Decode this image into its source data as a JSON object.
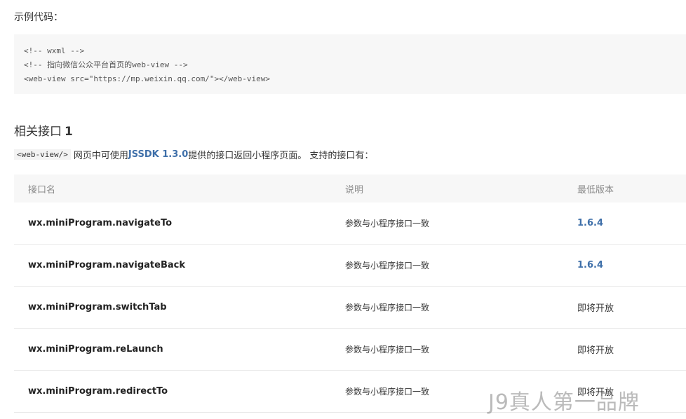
{
  "intro_label": "示例代码：",
  "code_lines": [
    "<!-- wxml -->",
    "<!-- 指向微信公众平台首页的web-view -->",
    "<web-view src=\"https://mp.weixin.qq.com/\"></web-view>"
  ],
  "section": {
    "title": "相关接口",
    "number": "1"
  },
  "description": {
    "inline_code": "<web-view/>",
    "text_before": "网页中可使用",
    "link": "JSSDK 1.3.0",
    "text_after": "提供的接口返回小程序页面。 支持的接口有："
  },
  "table": {
    "headers": [
      "接口名",
      "说明",
      "最低版本"
    ],
    "rows": [
      {
        "name": "wx.miniProgram.navigateTo",
        "note": "参数与小程序接口一致",
        "version": "1.6.4",
        "version_is_link": true
      },
      {
        "name": "wx.miniProgram.navigateBack",
        "note": "参数与小程序接口一致",
        "version": "1.6.4",
        "version_is_link": true
      },
      {
        "name": "wx.miniProgram.switchTab",
        "note": "参数与小程序接口一致",
        "version": "即将开放",
        "version_is_link": false
      },
      {
        "name": "wx.miniProgram.reLaunch",
        "note": "参数与小程序接口一致",
        "version": "即将开放",
        "version_is_link": false
      },
      {
        "name": "wx.miniProgram.redirectTo",
        "note": "参数与小程序接口一致",
        "version": "即将开放",
        "version_is_link": false
      }
    ]
  },
  "watermark": "J9真人第一品牌",
  "colors": {
    "link": "#3e6fa9",
    "code_bg": "#f7f7f7",
    "header_bg": "#f7f7f7"
  }
}
